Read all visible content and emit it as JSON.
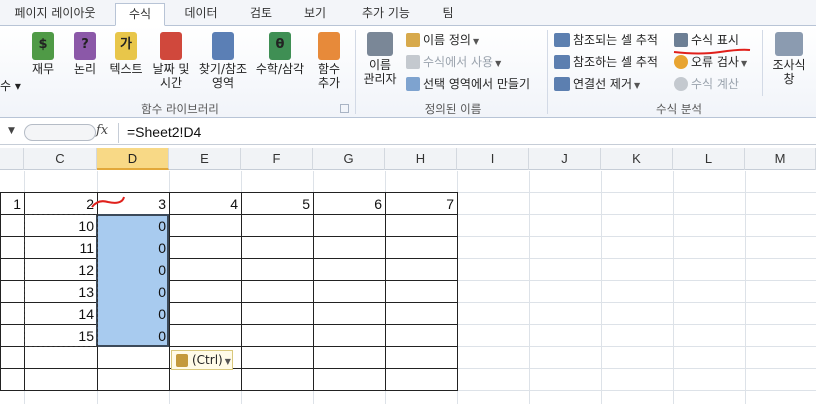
{
  "tabs": [
    {
      "label": "페이지 레이아웃",
      "active": false
    },
    {
      "label": "수식",
      "active": true
    },
    {
      "label": "데이터",
      "active": false
    },
    {
      "label": "검토",
      "active": false
    },
    {
      "label": "보기",
      "active": false
    },
    {
      "label": "추가 기능",
      "active": false
    },
    {
      "label": "팀",
      "active": false
    }
  ],
  "ribbon": {
    "function_library": {
      "title": "함수 라이브러리",
      "partial_left": "수 ▾",
      "buttons": [
        {
          "line1": "재무",
          "line2": "",
          "icon": "financial-book-icon",
          "glyph": "$",
          "color": "#4f9a46"
        },
        {
          "line1": "논리",
          "line2": "",
          "icon": "logical-book-icon",
          "glyph": "?",
          "color": "#8b58a8"
        },
        {
          "line1": "텍스트",
          "line2": "",
          "icon": "text-book-icon",
          "glyph": "가",
          "color": "#e8c64a"
        },
        {
          "line1": "날짜 및",
          "line2": "시간",
          "icon": "datetime-book-icon",
          "glyph": "",
          "color": "#d0483c"
        },
        {
          "line1": "찾기/참조",
          "line2": "영역",
          "icon": "lookup-magnifier-icon",
          "glyph": "",
          "color": "#5b7fb5"
        },
        {
          "line1": "수학/삼각",
          "line2": "",
          "icon": "math-book-icon",
          "glyph": "θ",
          "color": "#3f8f54"
        },
        {
          "line1": "함수",
          "line2": "추가",
          "icon": "more-functions-book-icon",
          "glyph": "",
          "color": "#e78a3a"
        }
      ]
    },
    "defined_names": {
      "title": "정의된 이름",
      "manager_line1": "이름",
      "manager_line2": "관리자",
      "define_name": "이름 정의",
      "use_in_formula": "수식에서 사용",
      "create_from_selection": "선택 영역에서 만들기"
    },
    "formula_auditing": {
      "title": "수식 분석",
      "trace_precedents": "참조되는 셀 추적",
      "trace_dependents": "참조하는 셀 추적",
      "remove_arrows": "연결선 제거",
      "show_formulas": "수식 표시",
      "error_checking": "오류 검사",
      "evaluate_formula": "수식 계산",
      "watch_line1": "조사식",
      "watch_line2": "창"
    }
  },
  "formula_bar": {
    "fx_label": "fx",
    "formula": "=Sheet2!D4"
  },
  "columns": [
    {
      "label": "",
      "selected": false
    },
    {
      "label": "C",
      "selected": false
    },
    {
      "label": "D",
      "selected": true
    },
    {
      "label": "E",
      "selected": false
    },
    {
      "label": "F",
      "selected": false
    },
    {
      "label": "G",
      "selected": false
    },
    {
      "label": "H",
      "selected": false
    },
    {
      "label": "I",
      "selected": false
    },
    {
      "label": "J",
      "selected": false
    },
    {
      "label": "K",
      "selected": false
    },
    {
      "label": "L",
      "selected": false
    },
    {
      "label": "M",
      "selected": false
    }
  ],
  "rows": [
    [
      "",
      "",
      "",
      "",
      "",
      "",
      ""
    ],
    [
      "1",
      "2",
      "3",
      "4",
      "5",
      "6",
      "7"
    ],
    [
      "",
      "10",
      "0",
      "",
      "",
      "",
      ""
    ],
    [
      "",
      "11",
      "0",
      "",
      "",
      "",
      ""
    ],
    [
      "",
      "12",
      "0",
      "",
      "",
      "",
      ""
    ],
    [
      "",
      "13",
      "0",
      "",
      "",
      "",
      ""
    ],
    [
      "",
      "14",
      "0",
      "",
      "",
      "",
      ""
    ],
    [
      "",
      "15",
      "0",
      "",
      "",
      "",
      ""
    ],
    [
      "",
      "",
      "",
      "",
      "",
      "",
      ""
    ],
    [
      "",
      "",
      "",
      "",
      "",
      "",
      ""
    ]
  ],
  "paste_options": "(Ctrl)",
  "colors": {
    "selection_fill": "#a8cbef",
    "annotation_red": "#e0201b",
    "active_column": "#f8d986"
  }
}
